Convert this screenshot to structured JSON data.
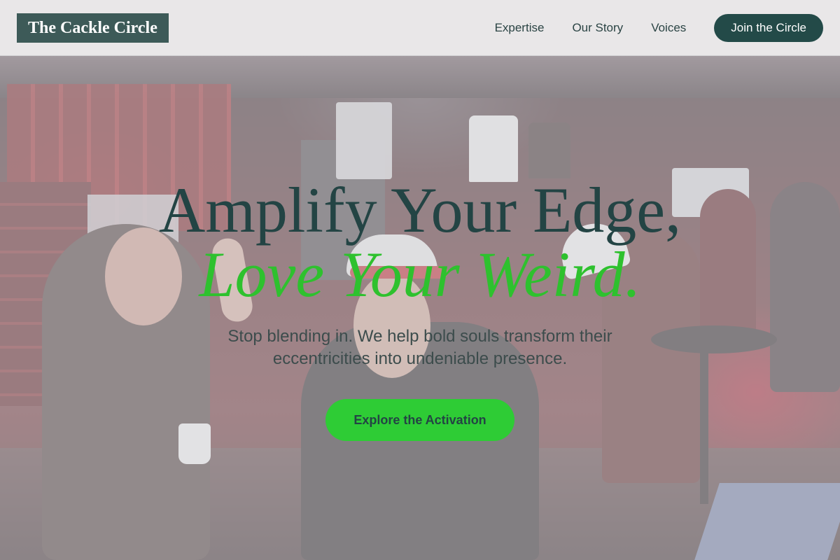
{
  "header": {
    "logo": "The Cackle Circle",
    "nav": [
      {
        "label": "Expertise"
      },
      {
        "label": "Our Story"
      },
      {
        "label": "Voices"
      }
    ],
    "cta_label": "Join the Circle"
  },
  "hero": {
    "headline_line1": "Amplify Your Edge,",
    "headline_line2": "Love Your Weird.",
    "subtext": "Stop blending in. We help bold souls transform their eccentricities into undeniable presence.",
    "cta_label": "Explore the Activation"
  },
  "colors": {
    "brand_dark": "#234a48",
    "accent_green": "#2ecc35",
    "header_bg": "#e9e7e8"
  }
}
